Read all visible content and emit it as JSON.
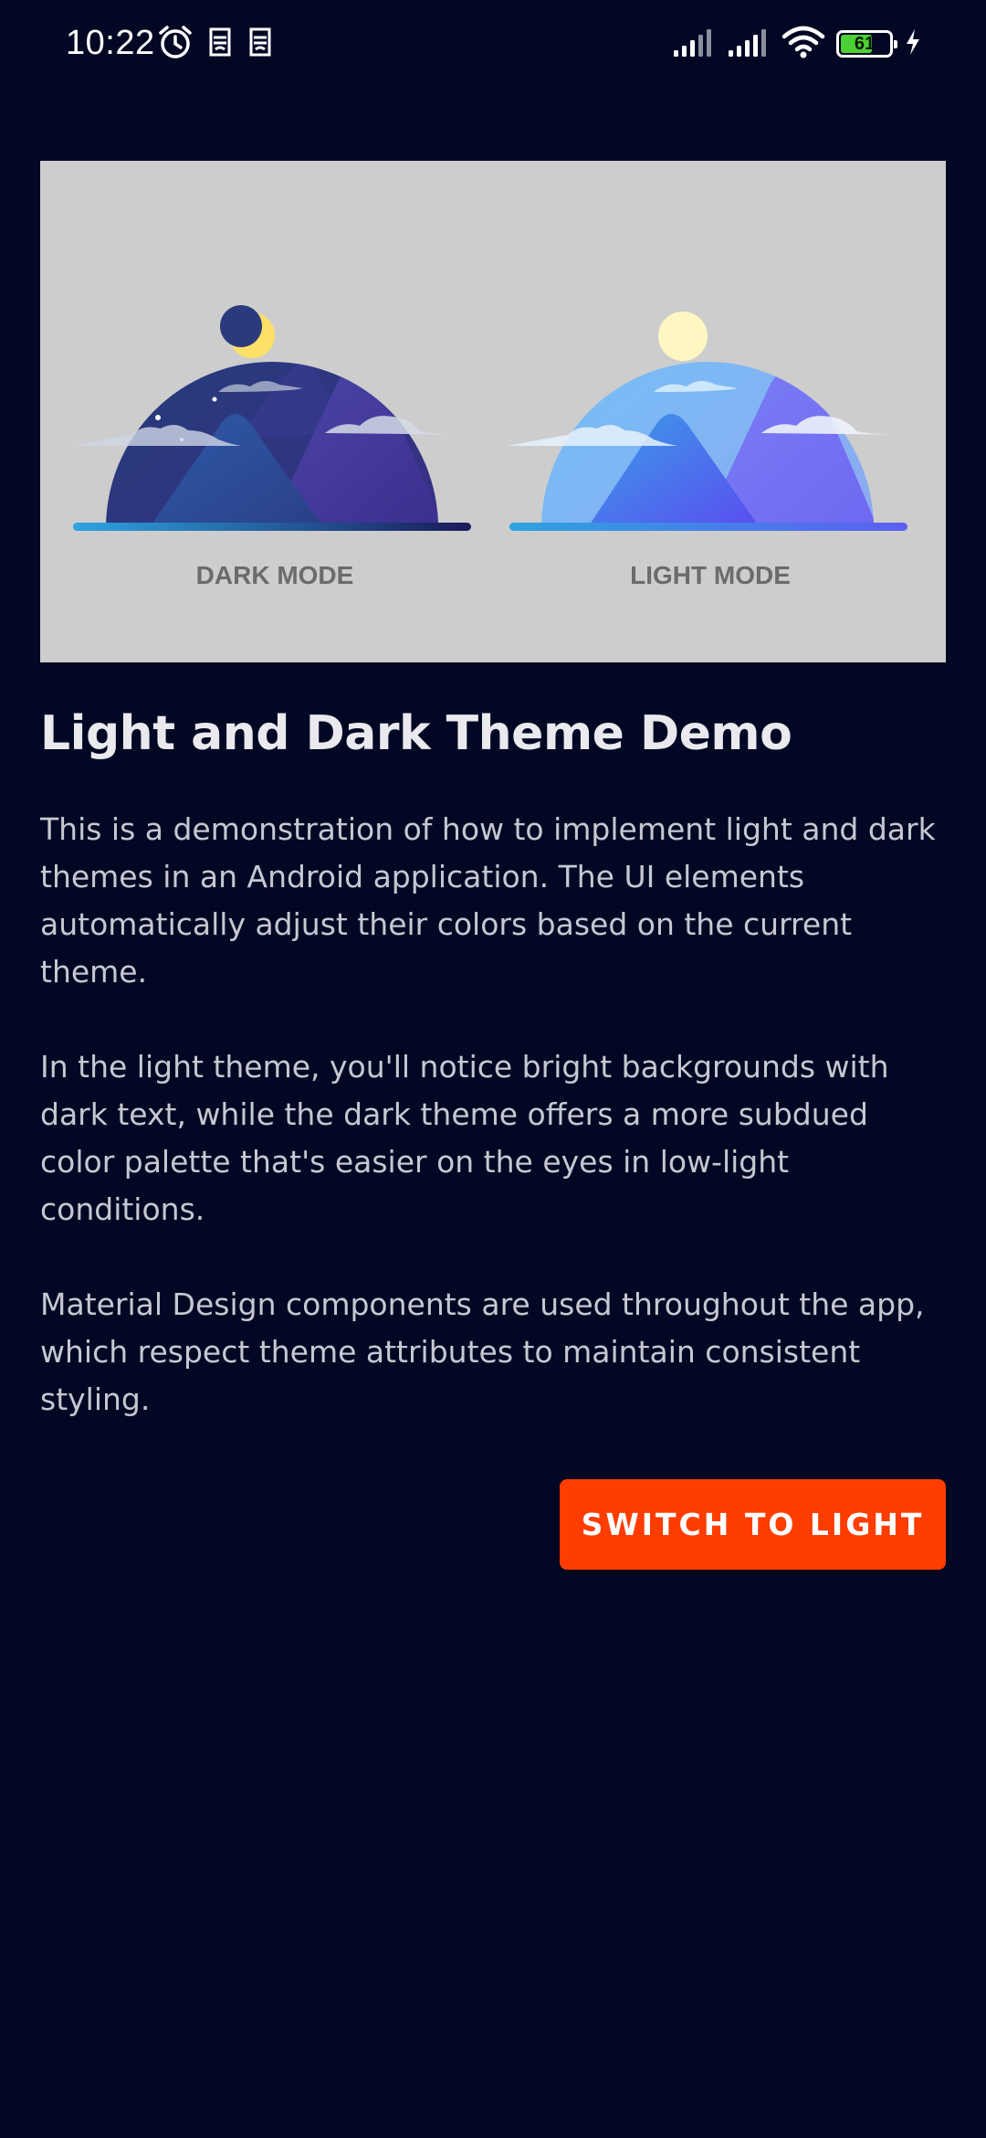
{
  "status_bar": {
    "time": "10:22",
    "battery_level": "61",
    "icons": [
      "alarm-icon",
      "sim-card-icon",
      "sim-card-icon",
      "cellular-signal-icon",
      "cellular-signal-icon",
      "wifi-icon",
      "battery-icon",
      "charging-icon"
    ]
  },
  "hero": {
    "dark_label": "DARK MODE",
    "light_label": "LIGHT MODE"
  },
  "content": {
    "title": "Light and Dark Theme Demo",
    "paragraph_1": "This is a demonstration of how to implement light and dark themes in an Android application. The UI elements automatically adjust their colors based on the current theme.",
    "paragraph_2": "In the light theme, you'll notice bright backgrounds with dark text, while the dark theme offers a more subdued color palette that's easier on the eyes in low-light conditions.",
    "paragraph_3": "Material Design components are used throughout the app, which respect theme attributes to maintain consistent styling."
  },
  "actions": {
    "switch_label": "SWITCH TO LIGHT"
  },
  "colors": {
    "background": "#020824",
    "accent": "#ff3d00",
    "hero_background": "#cdcdcd",
    "battery_fill": "#4cd137"
  }
}
